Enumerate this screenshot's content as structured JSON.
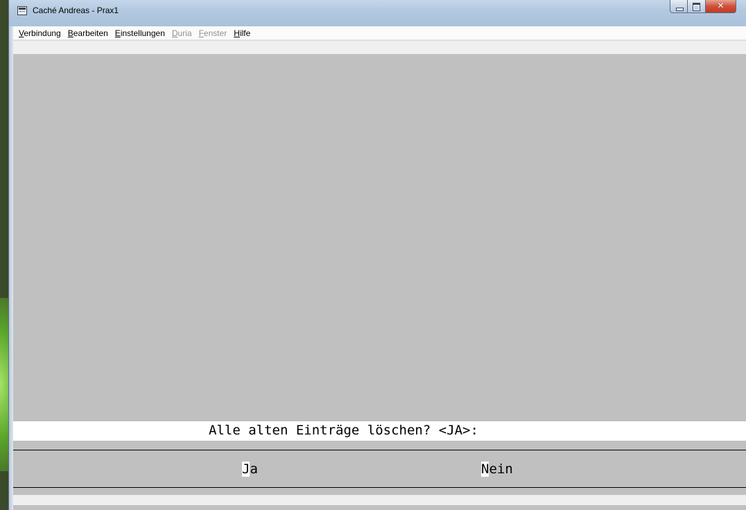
{
  "window": {
    "title": "Caché Andreas - Prax1",
    "icon": "terminal-app-icon",
    "buttons": {
      "minimize": "minimize-icon",
      "maximize": "maximize-icon",
      "close": "✕"
    }
  },
  "menu": [
    {
      "accel": "V",
      "rest": "erbindung",
      "enabled": true
    },
    {
      "accel": "B",
      "rest": "earbeiten",
      "enabled": true
    },
    {
      "accel": "E",
      "rest": "instellungen",
      "enabled": true
    },
    {
      "accel": "D",
      "rest": "uria",
      "enabled": false
    },
    {
      "accel": "F",
      "rest": "enster",
      "enabled": false
    },
    {
      "accel": "H",
      "rest": "ilfe",
      "enabled": true
    }
  ],
  "terminal": {
    "prompt": "Alle alten Einträge löschen? <JA>:",
    "options": [
      {
        "first": "J",
        "rest": "a"
      },
      {
        "first": "N",
        "rest": "ein"
      }
    ]
  },
  "colors": {
    "terminal_background": "#c0c0c0",
    "prompt_background": "#ffffff",
    "close_button": "#c23b22"
  }
}
